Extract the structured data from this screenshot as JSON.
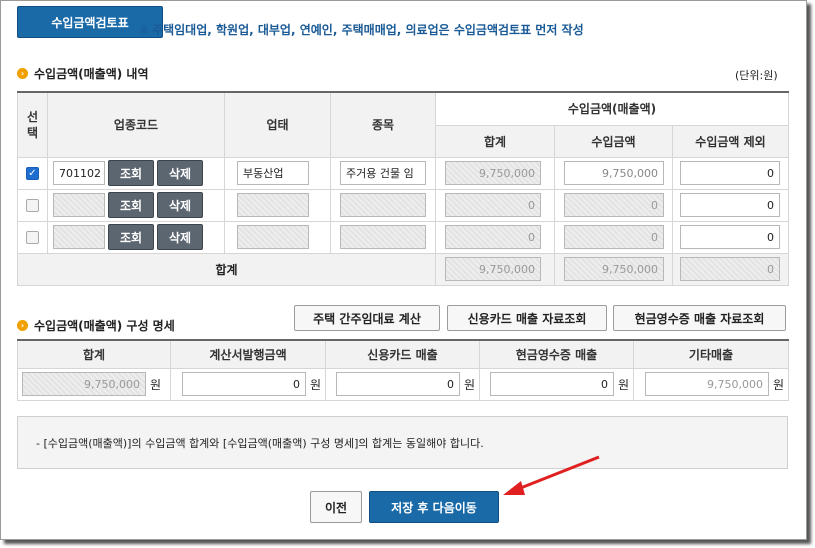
{
  "top": {
    "review_button": "수입금액검토표",
    "note_mark": "※",
    "note": "주택임대업, 학원업, 대부업, 연예인, 주택매매업, 의료업은 수입금액검토표 먼저 작성"
  },
  "revenue_section": {
    "title": "수입금액(매출액) 내역",
    "unit": "(단위:원)",
    "headers": {
      "select": "선택",
      "industry_code": "업종코드",
      "business_type": "업태",
      "item": "종목",
      "revenue_group": "수입금액(매출액)",
      "total": "합계",
      "revenue": "수입금액",
      "excluded": "수입금액 제외"
    },
    "lookup_label": "조회",
    "delete_label": "삭제",
    "rows": [
      {
        "checked": true,
        "code": "701102",
        "business_type": "부동산업",
        "item": "주거용 건물 임",
        "total": "9,750,000",
        "revenue": "9,750,000",
        "excluded": "0"
      },
      {
        "checked": false,
        "code": "",
        "business_type": "",
        "item": "",
        "total": "0",
        "revenue": "0",
        "excluded": "0"
      },
      {
        "checked": false,
        "code": "",
        "business_type": "",
        "item": "",
        "total": "0",
        "revenue": "0",
        "excluded": "0"
      }
    ],
    "sum_row": {
      "label": "합계",
      "total": "9,750,000",
      "revenue": "9,750,000",
      "excluded": "0"
    }
  },
  "composition_section": {
    "title": "수입금액(매출액) 구성 명세",
    "buttons": {
      "housing_rent": "주택 간주임대료 계산",
      "credit_card": "신용카드 매출 자료조회",
      "cash_receipt": "현금영수증 매출 자료조회"
    },
    "headers": [
      "합계",
      "계산서발행금액",
      "신용카드 매출",
      "현금영수증 매출",
      "기타매출"
    ],
    "won": "원",
    "values": {
      "total": "9,750,000",
      "invoice": "0",
      "credit_card": "0",
      "cash_receipt": "0",
      "other": "9,750,000"
    }
  },
  "note_box": "- [수입금액(매출액)]의 수입금액 합계와 [수입금액(매출액) 구성 명세]의 합계는 동일해야 합니다.",
  "footer": {
    "prev": "이전",
    "save_next": "저장 후 다음이동"
  },
  "colors": {
    "primary": "#1a6aa8",
    "dark_button": "#5c6670",
    "bullet": "#f0a000",
    "note_text": "#1a5a96",
    "arrow": "#e02020"
  }
}
